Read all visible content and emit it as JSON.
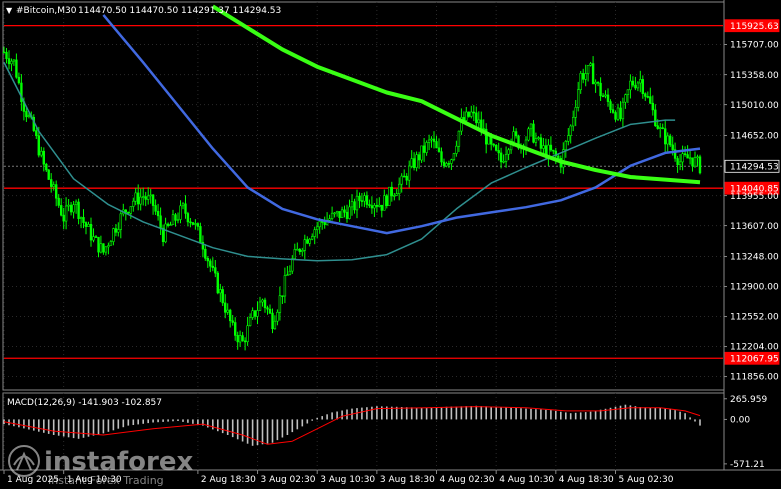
{
  "header": {
    "symbol": "#Bitcoin,M30",
    "ohlc": "114470.50 114470.50 114291.37 114294.53"
  },
  "indicator": {
    "macd_label": "MACD(12,26,9) -141.903 -102.857"
  },
  "colors": {
    "background": "#000000",
    "candle": "#00ff00",
    "ma_fast": "#2f8f8f",
    "ma_mid": "#4169e1",
    "ma_slow": "#39ff14",
    "level": "#ff0000",
    "signal": "#ff0000",
    "histogram": "#c0c0c0",
    "axis_text": "#ffffff"
  },
  "chart_data": [
    {
      "type": "candlestick",
      "title": "#Bitcoin,M30",
      "ylim": [
        111700,
        116200
      ],
      "price_ticks": [
        {
          "value": 115925.63,
          "text": "115925.63",
          "kind": "level"
        },
        {
          "value": 115707.0,
          "text": "115707.00"
        },
        {
          "value": 115358.0,
          "text": "115358.00"
        },
        {
          "value": 115010.0,
          "text": "115010.00"
        },
        {
          "value": 114652.0,
          "text": "114652.00"
        },
        {
          "value": 114294.53,
          "text": "114294.53",
          "kind": "current"
        },
        {
          "value": 114040.85,
          "text": "114040.85",
          "kind": "level"
        },
        {
          "value": 113955.0,
          "text": "113955.00"
        },
        {
          "value": 113607.0,
          "text": "113607.00"
        },
        {
          "value": 113248.0,
          "text": "113248.00"
        },
        {
          "value": 112900.0,
          "text": "112900.00"
        },
        {
          "value": 112552.0,
          "text": "112552.00"
        },
        {
          "value": 112204.0,
          "text": "112204.00"
        },
        {
          "value": 112067.95,
          "text": "112067.95",
          "kind": "level"
        },
        {
          "value": 111856.0,
          "text": "111856.00"
        }
      ],
      "levels": [
        115925.63,
        114040.85,
        112067.95
      ],
      "current_price": 114294.53,
      "close_path": [
        [
          0,
          115620
        ],
        [
          4,
          115500
        ],
        [
          8,
          115000
        ],
        [
          12,
          114700
        ],
        [
          16,
          114300
        ],
        [
          20,
          114000
        ],
        [
          24,
          113700
        ],
        [
          28,
          113900
        ],
        [
          32,
          113650
        ],
        [
          36,
          113450
        ],
        [
          40,
          113300
        ],
        [
          44,
          113550
        ],
        [
          48,
          113750
        ],
        [
          52,
          113900
        ],
        [
          56,
          113950
        ],
        [
          60,
          113850
        ],
        [
          64,
          113500
        ],
        [
          68,
          113650
        ],
        [
          72,
          113800
        ],
        [
          76,
          113650
        ],
        [
          80,
          113400
        ],
        [
          84,
          113050
        ],
        [
          88,
          112750
        ],
        [
          92,
          112400
        ],
        [
          96,
          112250
        ],
        [
          100,
          112550
        ],
        [
          104,
          112750
        ],
        [
          108,
          112500
        ],
        [
          112,
          112850
        ],
        [
          116,
          113200
        ],
        [
          120,
          113400
        ],
        [
          124,
          113550
        ],
        [
          128,
          113650
        ],
        [
          132,
          113700
        ],
        [
          136,
          113750
        ],
        [
          140,
          113800
        ],
        [
          144,
          113950
        ],
        [
          148,
          113900
        ],
        [
          152,
          113850
        ],
        [
          156,
          114000
        ],
        [
          160,
          114100
        ],
        [
          164,
          114300
        ],
        [
          168,
          114450
        ],
        [
          172,
          114600
        ],
        [
          176,
          114350
        ],
        [
          180,
          114400
        ],
        [
          184,
          114800
        ],
        [
          188,
          114900
        ],
        [
          192,
          114750
        ],
        [
          196,
          114500
        ],
        [
          200,
          114350
        ],
        [
          204,
          114650
        ],
        [
          208,
          114550
        ],
        [
          212,
          114700
        ],
        [
          216,
          114500
        ],
        [
          220,
          114450
        ],
        [
          224,
          114350
        ],
        [
          228,
          114750
        ],
        [
          232,
          115350
        ],
        [
          236,
          115400
        ],
        [
          240,
          115150
        ],
        [
          244,
          115000
        ],
        [
          248,
          114850
        ],
        [
          252,
          115250
        ],
        [
          256,
          115300
        ],
        [
          260,
          115000
        ],
        [
          264,
          114700
        ],
        [
          268,
          114550
        ],
        [
          272,
          114350
        ],
        [
          276,
          114400
        ],
        [
          280,
          114294.53
        ]
      ],
      "ma_fast": [
        [
          0,
          115500
        ],
        [
          14,
          114700
        ],
        [
          28,
          114150
        ],
        [
          42,
          113850
        ],
        [
          56,
          113650
        ],
        [
          70,
          113500
        ],
        [
          84,
          113350
        ],
        [
          98,
          113250
        ],
        [
          112,
          113220
        ],
        [
          126,
          113200
        ],
        [
          140,
          113210
        ],
        [
          154,
          113270
        ],
        [
          168,
          113450
        ],
        [
          182,
          113800
        ],
        [
          196,
          114100
        ],
        [
          210,
          114280
        ],
        [
          224,
          114450
        ],
        [
          238,
          114620
        ],
        [
          252,
          114780
        ],
        [
          266,
          114830
        ],
        [
          270,
          114830
        ]
      ],
      "ma_mid": [
        [
          40,
          116050
        ],
        [
          56,
          115500
        ],
        [
          70,
          115000
        ],
        [
          84,
          114500
        ],
        [
          98,
          114050
        ],
        [
          112,
          113800
        ],
        [
          126,
          113680
        ],
        [
          140,
          113600
        ],
        [
          154,
          113520
        ],
        [
          168,
          113600
        ],
        [
          182,
          113700
        ],
        [
          196,
          113760
        ],
        [
          210,
          113820
        ],
        [
          224,
          113900
        ],
        [
          238,
          114050
        ],
        [
          252,
          114300
        ],
        [
          266,
          114450
        ],
        [
          280,
          114500
        ]
      ],
      "ma_slow": [
        [
          84,
          116150
        ],
        [
          98,
          115900
        ],
        [
          112,
          115650
        ],
        [
          126,
          115450
        ],
        [
          140,
          115300
        ],
        [
          154,
          115150
        ],
        [
          168,
          115050
        ],
        [
          182,
          114850
        ],
        [
          196,
          114650
        ],
        [
          210,
          114500
        ],
        [
          224,
          114350
        ],
        [
          238,
          114250
        ],
        [
          252,
          114170
        ],
        [
          266,
          114140
        ],
        [
          280,
          114110
        ]
      ]
    },
    {
      "type": "histogram",
      "title": "MACD(12,26,9) -141.903 -102.857",
      "ylim": [
        -650,
        340
      ],
      "ticks": [
        {
          "value": 265.959,
          "text": "265.959"
        },
        {
          "value": 0,
          "text": "0.00"
        },
        {
          "value": -571.21,
          "text": "-571.21"
        }
      ],
      "hist_path": [
        [
          0,
          -60
        ],
        [
          10,
          -130
        ],
        [
          20,
          -200
        ],
        [
          30,
          -250
        ],
        [
          40,
          -180
        ],
        [
          50,
          -80
        ],
        [
          60,
          -40
        ],
        [
          70,
          -20
        ],
        [
          80,
          -80
        ],
        [
          90,
          -200
        ],
        [
          100,
          -340
        ],
        [
          108,
          -300
        ],
        [
          114,
          -200
        ],
        [
          120,
          -90
        ],
        [
          126,
          20
        ],
        [
          132,
          90
        ],
        [
          140,
          140
        ],
        [
          150,
          170
        ],
        [
          160,
          160
        ],
        [
          170,
          150
        ],
        [
          180,
          165
        ],
        [
          190,
          175
        ],
        [
          200,
          160
        ],
        [
          210,
          140
        ],
        [
          220,
          120
        ],
        [
          228,
          80
        ],
        [
          236,
          100
        ],
        [
          244,
          150
        ],
        [
          250,
          190
        ],
        [
          256,
          160
        ],
        [
          262,
          150
        ],
        [
          268,
          140
        ],
        [
          274,
          80
        ],
        [
          280,
          -80
        ]
      ],
      "signal_path": [
        [
          0,
          -30
        ],
        [
          20,
          -150
        ],
        [
          40,
          -200
        ],
        [
          60,
          -120
        ],
        [
          80,
          -60
        ],
        [
          96,
          -200
        ],
        [
          106,
          -320
        ],
        [
          116,
          -280
        ],
        [
          126,
          -120
        ],
        [
          136,
          40
        ],
        [
          150,
          140
        ],
        [
          170,
          150
        ],
        [
          190,
          165
        ],
        [
          210,
          150
        ],
        [
          226,
          110
        ],
        [
          240,
          110
        ],
        [
          252,
          150
        ],
        [
          264,
          150
        ],
        [
          274,
          110
        ],
        [
          280,
          50
        ]
      ]
    }
  ],
  "time_axis": {
    "labels": [
      {
        "bar": 0,
        "text": "1 Aug 2025"
      },
      {
        "bar": 24,
        "text": "1 Aug 10:30"
      },
      {
        "bar": 78,
        "text": "2 Aug 18:30"
      },
      {
        "bar": 102,
        "text": "3 Aug 02:30"
      },
      {
        "bar": 126,
        "text": "3 Aug 10:30"
      },
      {
        "bar": 150,
        "text": "3 Aug 18:30"
      },
      {
        "bar": 174,
        "text": "4 Aug 02:30"
      },
      {
        "bar": 198,
        "text": "4 Aug 10:30"
      },
      {
        "bar": 222,
        "text": "4 Aug 18:30"
      },
      {
        "bar": 246,
        "text": "5 Aug 02:30"
      }
    ]
  },
  "watermark": {
    "brand": "instaforex",
    "tagline": "Instant Forex Trading"
  }
}
